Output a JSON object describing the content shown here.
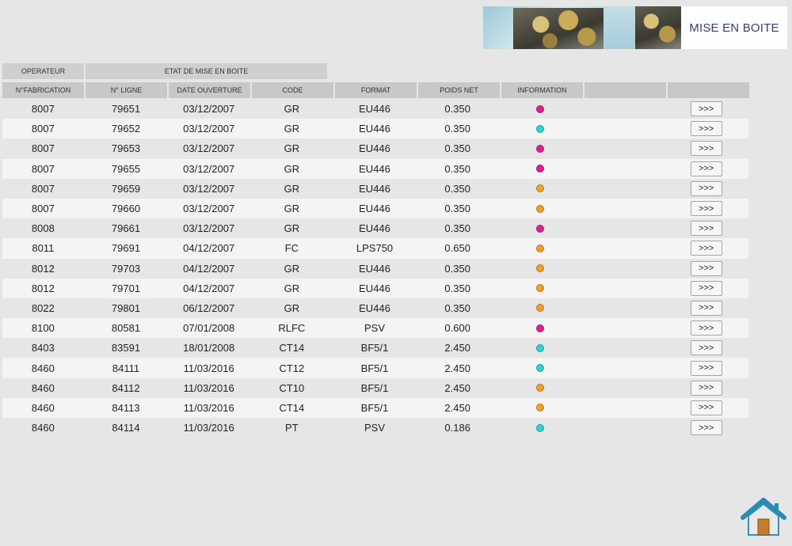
{
  "banner": {
    "title": "MISE EN BOITE"
  },
  "groups": {
    "operateur": "OPERATEUR",
    "etat": "ETAT DE MISE EN BOITE"
  },
  "columns": [
    "N°FABRICATION",
    "N° LIGNE",
    "DATE OUVERTURE",
    "CODE",
    "FORMAT",
    "POIDS NET",
    "INFORMATION",
    "",
    ""
  ],
  "colors": {
    "pink": "#e0208e",
    "cyan": "#2fd3d0",
    "orange": "#f0a02a"
  },
  "action_label": ">>>",
  "rows": [
    {
      "fab": "8007",
      "ligne": "79651",
      "date": "03/12/2007",
      "code": "GR",
      "format": "EU446",
      "poids": "0.350",
      "info": "pink"
    },
    {
      "fab": "8007",
      "ligne": "79652",
      "date": "03/12/2007",
      "code": "GR",
      "format": "EU446",
      "poids": "0.350",
      "info": "cyan"
    },
    {
      "fab": "8007",
      "ligne": "79653",
      "date": "03/12/2007",
      "code": "GR",
      "format": "EU446",
      "poids": "0.350",
      "info": "pink"
    },
    {
      "fab": "8007",
      "ligne": "79655",
      "date": "03/12/2007",
      "code": "GR",
      "format": "EU446",
      "poids": "0.350",
      "info": "pink"
    },
    {
      "fab": "8007",
      "ligne": "79659",
      "date": "03/12/2007",
      "code": "GR",
      "format": "EU446",
      "poids": "0.350",
      "info": "orange"
    },
    {
      "fab": "8007",
      "ligne": "79660",
      "date": "03/12/2007",
      "code": "GR",
      "format": "EU446",
      "poids": "0.350",
      "info": "orange"
    },
    {
      "fab": "8008",
      "ligne": "79661",
      "date": "03/12/2007",
      "code": "GR",
      "format": "EU446",
      "poids": "0.350",
      "info": "pink"
    },
    {
      "fab": "8011",
      "ligne": "79691",
      "date": "04/12/2007",
      "code": "FC",
      "format": "LPS750",
      "poids": "0.650",
      "info": "orange"
    },
    {
      "fab": "8012",
      "ligne": "79703",
      "date": "04/12/2007",
      "code": "GR",
      "format": "EU446",
      "poids": "0.350",
      "info": "orange"
    },
    {
      "fab": "8012",
      "ligne": "79701",
      "date": "04/12/2007",
      "code": "GR",
      "format": "EU446",
      "poids": "0.350",
      "info": "orange"
    },
    {
      "fab": "8022",
      "ligne": "79801",
      "date": "06/12/2007",
      "code": "GR",
      "format": "EU446",
      "poids": "0.350",
      "info": "orange"
    },
    {
      "fab": "8100",
      "ligne": "80581",
      "date": "07/01/2008",
      "code": "RLFC",
      "format": "PSV",
      "poids": "0.600",
      "info": "pink"
    },
    {
      "fab": "8403",
      "ligne": "83591",
      "date": "18/01/2008",
      "code": "CT14",
      "format": "BF5/1",
      "poids": "2.450",
      "info": "cyan"
    },
    {
      "fab": "8460",
      "ligne": "84111",
      "date": "11/03/2016",
      "code": "CT12",
      "format": "BF5/1",
      "poids": "2.450",
      "info": "cyan"
    },
    {
      "fab": "8460",
      "ligne": "84112",
      "date": "11/03/2016",
      "code": "CT10",
      "format": "BF5/1",
      "poids": "2.450",
      "info": "orange"
    },
    {
      "fab": "8460",
      "ligne": "84113",
      "date": "11/03/2016",
      "code": "CT14",
      "format": "BF5/1",
      "poids": "2.450",
      "info": "orange"
    },
    {
      "fab": "8460",
      "ligne": "84114",
      "date": "11/03/2016",
      "code": "PT",
      "format": "PSV",
      "poids": "0.186",
      "info": "cyan"
    }
  ]
}
